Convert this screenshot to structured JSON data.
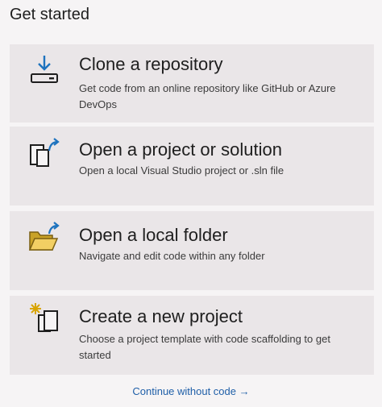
{
  "header": {
    "title": "Get started"
  },
  "cards": [
    {
      "heading": "Clone a repository",
      "description": "Get code from an online repository like GitHub or Azure DevOps",
      "icon": "clone-download-icon"
    },
    {
      "heading": "Open a project or solution",
      "description": "Open a local Visual Studio project or .sln file",
      "icon": "open-project-icon"
    },
    {
      "heading": "Open a local folder",
      "description": "Navigate and edit code within any folder",
      "icon": "open-folder-icon"
    },
    {
      "heading": "Create a new project",
      "description": "Choose a project template with code scaffolding to get started",
      "icon": "new-project-icon"
    }
  ],
  "footer": {
    "continue_label": "Continue without code →"
  },
  "colors": {
    "background": "#f6f4f5",
    "card": "#eae6e8",
    "link": "#1f5fa8",
    "accent_blue": "#1e73be",
    "folder": "#c9a227",
    "star": "#d8a400"
  }
}
